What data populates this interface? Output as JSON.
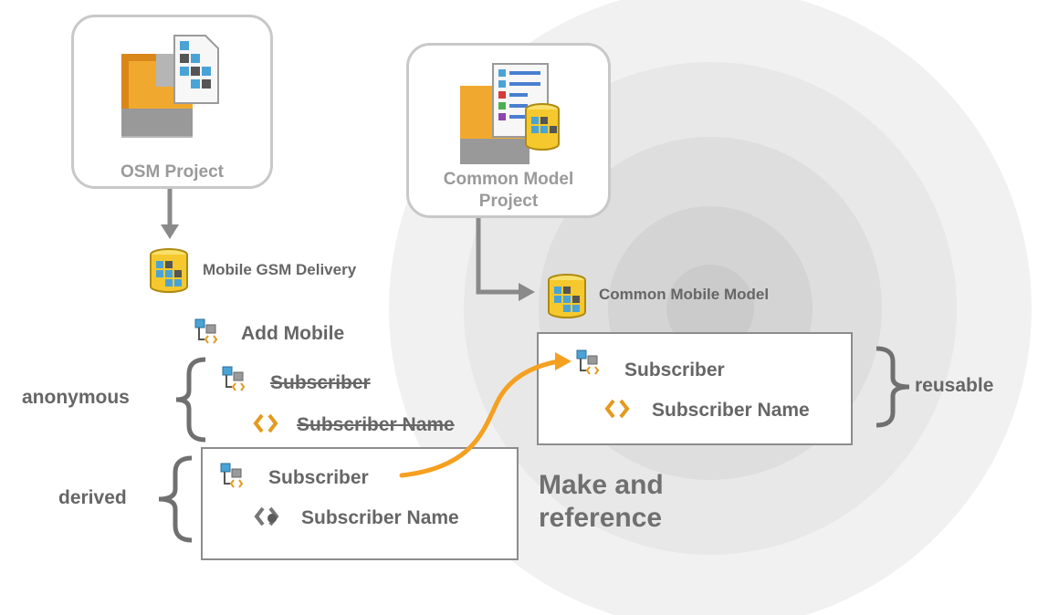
{
  "projects": {
    "osm": {
      "label": "OSM Project"
    },
    "common": {
      "label_line1": "Common Model",
      "label_line2": "Project"
    }
  },
  "databases": {
    "mobile_gsm": "Mobile GSM Delivery",
    "common_mobile": "Common Mobile Model"
  },
  "tree": {
    "add_mobile": "Add Mobile",
    "anonymous_subscriber": "Subscriber",
    "anonymous_subscriber_name": "Subscriber Name"
  },
  "derived_box": {
    "subscriber": "Subscriber",
    "subscriber_name": "Subscriber Name"
  },
  "reusable_box": {
    "subscriber": "Subscriber",
    "subscriber_name": "Subscriber Name"
  },
  "brace_labels": {
    "anonymous": "anonymous",
    "derived": "derived",
    "reusable": "reusable"
  },
  "callout": {
    "line1": "Make and",
    "line2": "reference"
  },
  "colors": {
    "arrow_orange": "#f5a020",
    "connector_gray": "#8a8a8a",
    "circle_base": "#efefef"
  }
}
